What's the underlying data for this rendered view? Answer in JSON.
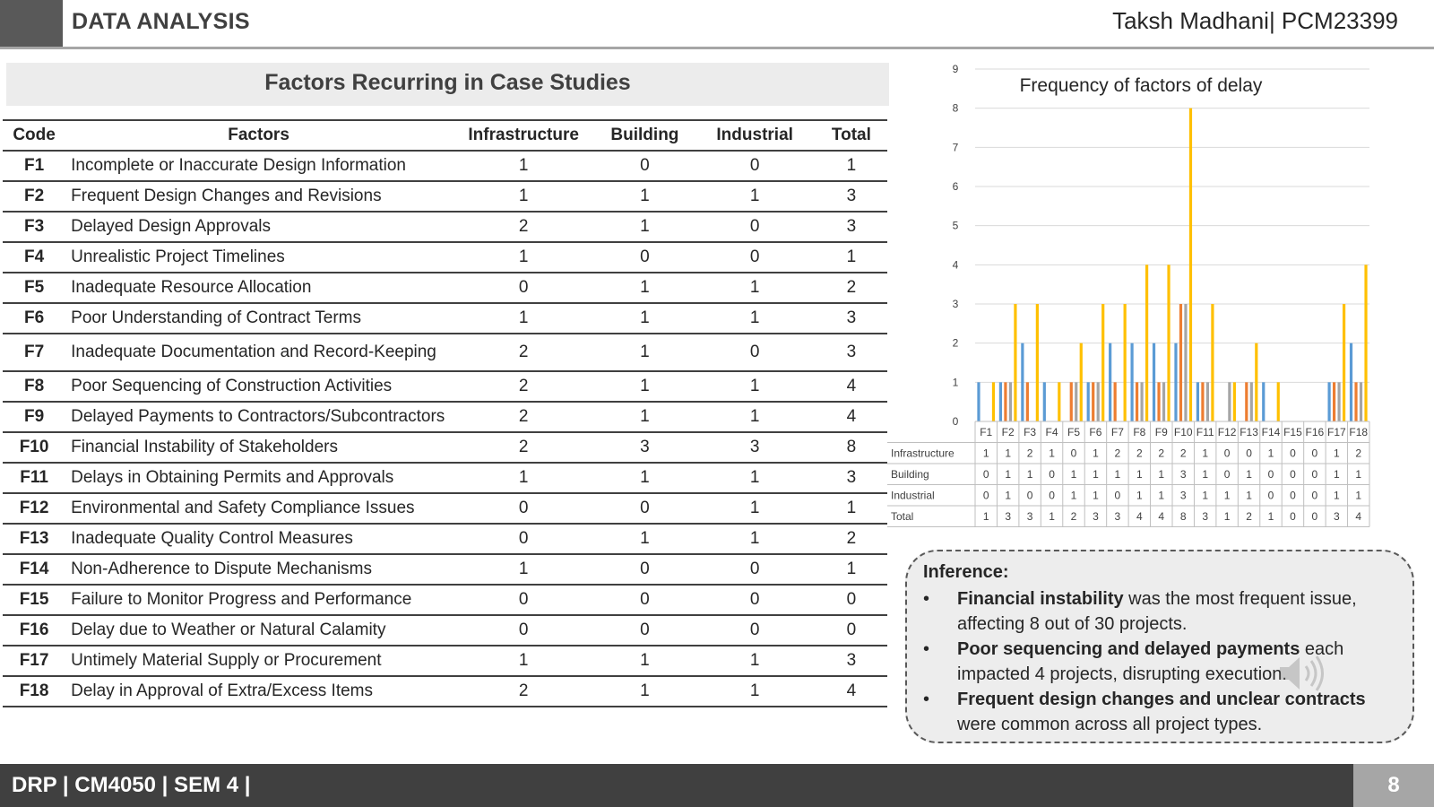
{
  "header": {
    "title": "DATA ANALYSIS",
    "author": "Taksh Madhani| PCM23399"
  },
  "table": {
    "title": "Factors Recurring in Case Studies",
    "headers": [
      "Code",
      "Factors",
      "Infrastructure",
      "Building",
      "Industrial",
      "Total"
    ],
    "rows": [
      {
        "code": "F1",
        "factor": "Incomplete or Inaccurate Design Information",
        "infrastructure": "1",
        "building": "0",
        "industrial": "0",
        "total": "1"
      },
      {
        "code": "F2",
        "factor": "Frequent Design Changes and Revisions",
        "infrastructure": "1",
        "building": "1",
        "industrial": "1",
        "total": "3"
      },
      {
        "code": "F3",
        "factor": "Delayed Design Approvals",
        "infrastructure": "2",
        "building": "1",
        "industrial": "0",
        "total": "3"
      },
      {
        "code": "F4",
        "factor": "Unrealistic Project Timelines",
        "infrastructure": "1",
        "building": "0",
        "industrial": "0",
        "total": "1"
      },
      {
        "code": "F5",
        "factor": "Inadequate Resource Allocation",
        "infrastructure": "0",
        "building": "1",
        "industrial": "1",
        "total": "2"
      },
      {
        "code": "F6",
        "factor": "Poor Understanding of Contract Terms",
        "infrastructure": "1",
        "building": "1",
        "industrial": "1",
        "total": "3"
      },
      {
        "code": "F7",
        "factor": "Inadequate Documentation and Record-Keeping",
        "infrastructure": "2",
        "building": "1",
        "industrial": "0",
        "total": "3"
      },
      {
        "code": "F8",
        "factor": "Poor Sequencing of Construction Activities",
        "infrastructure": "2",
        "building": "1",
        "industrial": "1",
        "total": "4"
      },
      {
        "code": "F9",
        "factor": "Delayed Payments to Contractors/Subcontractors",
        "infrastructure": "2",
        "building": "1",
        "industrial": "1",
        "total": "4"
      },
      {
        "code": "F10",
        "factor": "Financial Instability of Stakeholders",
        "infrastructure": "2",
        "building": "3",
        "industrial": "3",
        "total": "8"
      },
      {
        "code": "F11",
        "factor": "Delays in Obtaining Permits and Approvals",
        "infrastructure": "1",
        "building": "1",
        "industrial": "1",
        "total": "3"
      },
      {
        "code": "F12",
        "factor": "Environmental and Safety Compliance Issues",
        "infrastructure": "0",
        "building": "0",
        "industrial": "1",
        "total": "1"
      },
      {
        "code": "F13",
        "factor": "Inadequate Quality Control Measures",
        "infrastructure": "0",
        "building": "1",
        "industrial": "1",
        "total": "2"
      },
      {
        "code": "F14",
        "factor": "Non-Adherence to Dispute Mechanisms",
        "infrastructure": "1",
        "building": "0",
        "industrial": "0",
        "total": "1"
      },
      {
        "code": "F15",
        "factor": "Failure to Monitor Progress and Performance",
        "infrastructure": "0",
        "building": "0",
        "industrial": "0",
        "total": "0"
      },
      {
        "code": "F16",
        "factor": "Delay due to Weather or Natural Calamity",
        "infrastructure": "0",
        "building": "0",
        "industrial": "0",
        "total": "0"
      },
      {
        "code": "F17",
        "factor": "Untimely Material Supply or Procurement",
        "infrastructure": "1",
        "building": "1",
        "industrial": "1",
        "total": "3"
      },
      {
        "code": "F18",
        "factor": "Delay in Approval of Extra/Excess Items",
        "infrastructure": "2",
        "building": "1",
        "industrial": "1",
        "total": "4"
      }
    ]
  },
  "chart_data": {
    "type": "bar",
    "title": "Frequency of factors of delay",
    "categories": [
      "F1",
      "F2",
      "F3",
      "F4",
      "F5",
      "F6",
      "F7",
      "F8",
      "F9",
      "F10",
      "F11",
      "F12",
      "F13",
      "F14",
      "F15",
      "F16",
      "F17",
      "F18"
    ],
    "series": [
      {
        "name": "Infrastructure",
        "color": "#5b9bd5",
        "values": [
          1,
          1,
          2,
          1,
          0,
          1,
          2,
          2,
          2,
          2,
          1,
          0,
          0,
          1,
          0,
          0,
          1,
          2
        ]
      },
      {
        "name": "Building",
        "color": "#ed7d31",
        "values": [
          0,
          1,
          1,
          0,
          1,
          1,
          1,
          1,
          1,
          3,
          1,
          0,
          1,
          0,
          0,
          0,
          1,
          1
        ]
      },
      {
        "name": "Industrial",
        "color": "#a5a5a5",
        "values": [
          0,
          1,
          0,
          0,
          1,
          1,
          0,
          1,
          1,
          3,
          1,
          1,
          1,
          0,
          0,
          0,
          1,
          1
        ]
      },
      {
        "name": "Total",
        "color": "#ffc000",
        "values": [
          1,
          3,
          3,
          1,
          2,
          3,
          3,
          4,
          4,
          8,
          3,
          1,
          2,
          1,
          0,
          0,
          3,
          4
        ]
      }
    ],
    "ylim": [
      0,
      9
    ],
    "yticks": [
      0,
      1,
      2,
      3,
      4,
      5,
      6,
      7,
      8,
      9
    ],
    "grid": true,
    "legend": "data-table-below"
  },
  "inference": {
    "heading": "Inference:",
    "items": [
      {
        "bold": "Financial instability",
        "text": " was the most frequent issue, affecting 8 out of 30 projects."
      },
      {
        "bold": "Poor sequencing and delayed payments",
        "text": " each impacted 4 projects, disrupting execution."
      },
      {
        "bold": "Frequent design changes and unclear contracts",
        "text": " were common across all project types."
      }
    ],
    "bullet": "•"
  },
  "footer": {
    "text": "DRP | CM4050  | SEM 4 |",
    "page": "8"
  },
  "icons": {
    "speaker": "speaker-icon"
  }
}
